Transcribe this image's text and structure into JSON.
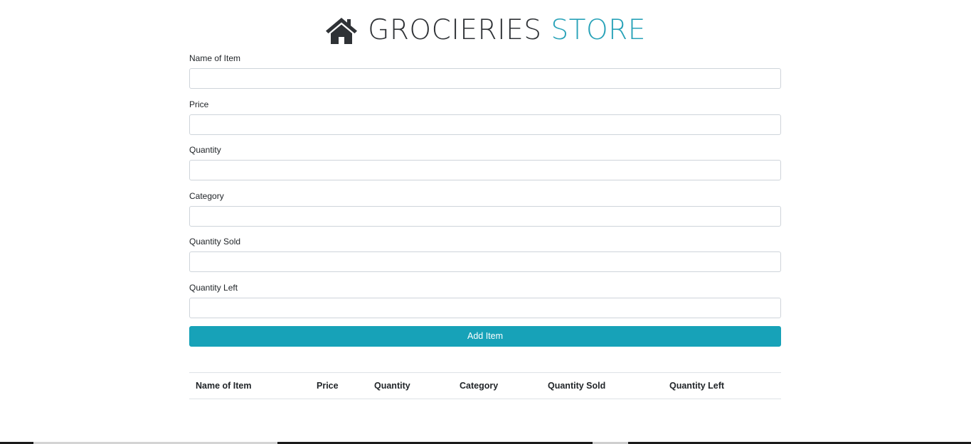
{
  "header": {
    "icon": "home-icon",
    "title_main": "GROCIERIES",
    "title_accent": "STORE",
    "colors": {
      "title_dark": "#2f3236",
      "title_accent": "#28a2b8"
    }
  },
  "form": {
    "fields": [
      {
        "label": "Name of Item",
        "value": "",
        "placeholder": ""
      },
      {
        "label": "Price",
        "value": "",
        "placeholder": ""
      },
      {
        "label": "Quantity",
        "value": "",
        "placeholder": ""
      },
      {
        "label": "Category",
        "value": "",
        "placeholder": ""
      },
      {
        "label": "Quantity Sold",
        "value": "",
        "placeholder": ""
      },
      {
        "label": "Quantity Left",
        "value": "",
        "placeholder": ""
      }
    ],
    "submit_label": "Add Item",
    "submit_color": "#17a2b8"
  },
  "table": {
    "columns": [
      "Name of Item",
      "Price",
      "Quantity",
      "Category",
      "Quantity Sold",
      "Quantity Left"
    ],
    "rows": []
  }
}
